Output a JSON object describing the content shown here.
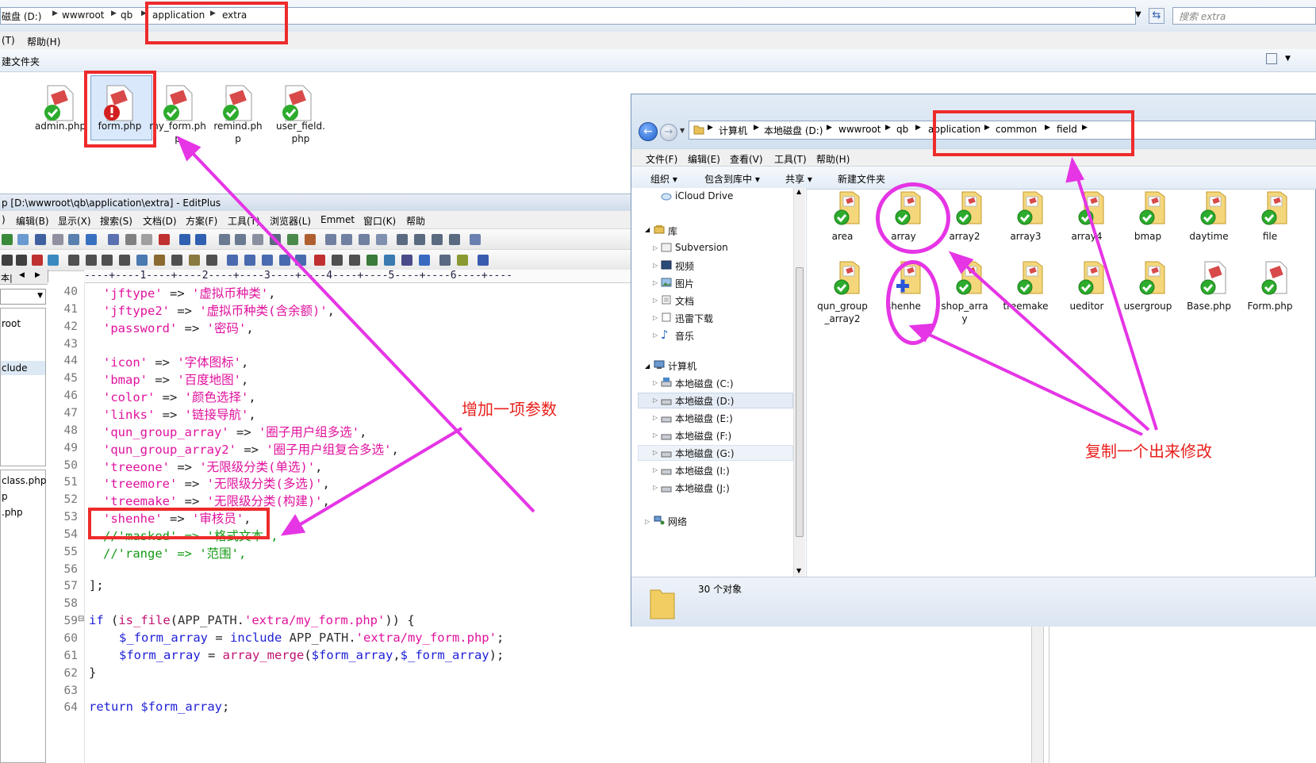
{
  "bg_explorer": {
    "breadcrumb": [
      "磁盘 (D:)",
      "wwwroot",
      "qb",
      "application",
      "extra"
    ],
    "search_placeholder": "搜索 extra",
    "menu": [
      "(T)",
      "帮助(H)"
    ],
    "cmd_label": "建文件夹",
    "files": [
      {
        "label": "admin.php",
        "status": "ok"
      },
      {
        "label": "form.php",
        "status": "error"
      },
      {
        "label": "my_form.php",
        "status": "ok"
      },
      {
        "label": "remind.php",
        "status": "ok"
      },
      {
        "label": "user_field.php",
        "status": "ok"
      }
    ]
  },
  "editplus": {
    "title": "p [D:\\wwwroot\\qb\\application\\extra] - EditPlus",
    "menu": [
      ")",
      "编辑(B)",
      "显示(X)",
      "搜索(S)",
      "文档(D)",
      "方案(F)",
      "工具(T)",
      "浏览器(L)",
      "Emmet",
      "窗口(K)",
      "帮助"
    ],
    "left_panel": [
      "本|",
      "root",
      "clude",
      "class.php",
      "p",
      ".php"
    ],
    "ruler": "----+----1----+----2----+----3----+----4----+----5----+----6----+----",
    "lines": [
      {
        "n": "40",
        "code": "'jftype' => '虚拟币种类',"
      },
      {
        "n": "41",
        "code": "'jftype2' => '虚拟币种类(含余额)',"
      },
      {
        "n": "42",
        "code": "'password' => '密码',"
      },
      {
        "n": "43",
        "code": ""
      },
      {
        "n": "44",
        "code": "'icon' => '字体图标',"
      },
      {
        "n": "45",
        "code": "'bmap' => '百度地图',"
      },
      {
        "n": "46",
        "code": "'color' => '颜色选择',"
      },
      {
        "n": "47",
        "code": "'links' => '链接导航',"
      },
      {
        "n": "48",
        "code": "'qun_group_array' => '圈子用户组多选',"
      },
      {
        "n": "49",
        "code": "'qun_group_array2' => '圈子用户组复合多选',"
      },
      {
        "n": "50",
        "code": "'treeone' => '无限级分类(单选)',"
      },
      {
        "n": "51",
        "code": "'treemore' => '无限级分类(多选)',"
      },
      {
        "n": "52",
        "code": "'treemake' => '无限级分类(构建)',"
      },
      {
        "n": "53",
        "code": "'shenhe' => '审核员',"
      },
      {
        "n": "54",
        "code": "//'masked' => '格式文本',"
      },
      {
        "n": "55",
        "code": "//'range' => '范围',"
      },
      {
        "n": "56",
        "code": ""
      },
      {
        "n": "57",
        "code": "];"
      },
      {
        "n": "58",
        "code": ""
      },
      {
        "n": "59",
        "code": "if (is_file(APP_PATH.'extra/my_form.php')) {"
      },
      {
        "n": "60",
        "code": "$_form_array = include APP_PATH.'extra/my_form.php';"
      },
      {
        "n": "61",
        "code": "$form_array = array_merge($form_array,$_form_array);"
      },
      {
        "n": "62",
        "code": "}"
      },
      {
        "n": "63",
        "code": ""
      },
      {
        "n": "64",
        "code": "return $form_array;"
      }
    ]
  },
  "explorer2": {
    "breadcrumb": [
      "计算机",
      "本地磁盘 (D:)",
      "wwwroot",
      "qb",
      "application",
      "common",
      "field"
    ],
    "menu": [
      "文件(F)",
      "编辑(E)",
      "查看(V)",
      "工具(T)",
      "帮助(H)"
    ],
    "commands": [
      "组织 ▾",
      "包含到库中 ▾",
      "共享 ▾",
      "新建文件夹"
    ],
    "sidebar": {
      "icloud": "iCloud Drive",
      "library": "库",
      "library_items": [
        "Subversion",
        "视频",
        "图片",
        "文档",
        "迅雷下载",
        "音乐"
      ],
      "computer": "计算机",
      "drives": [
        "本地磁盘 (C:)",
        "本地磁盘 (D:)",
        "本地磁盘 (E:)",
        "本地磁盘 (F:)",
        "本地磁盘 (G:)",
        "本地磁盘 (I:)",
        "本地磁盘 (J:)"
      ],
      "network": "网络"
    },
    "items_row1": [
      {
        "label": "area",
        "status": "ok"
      },
      {
        "label": "array",
        "status": "ok"
      },
      {
        "label": "array2",
        "status": "ok"
      },
      {
        "label": "array3",
        "status": "ok"
      },
      {
        "label": "array4",
        "status": "ok"
      },
      {
        "label": "bmap",
        "status": "ok"
      },
      {
        "label": "daytime",
        "status": "ok"
      },
      {
        "label": "file",
        "status": "ok"
      }
    ],
    "items_row2": [
      {
        "label": "qun_group_array2",
        "status": "ok"
      },
      {
        "label": "shenhe",
        "status": "add"
      },
      {
        "label": "shop_array",
        "status": "ok"
      },
      {
        "label": "treemake",
        "status": "ok"
      },
      {
        "label": "ueditor",
        "status": "ok"
      },
      {
        "label": "usergroup",
        "status": "ok"
      },
      {
        "label": "Base.php",
        "status": "ok"
      },
      {
        "label": "Form.php",
        "status": "ok"
      }
    ],
    "status_count": "30 个对象"
  },
  "annotations": {
    "add_param": "增加一项参数",
    "copy_modify": "复制一个出来修改"
  },
  "colors": {
    "annotation_red": "#ee2b2b",
    "annotation_magenta": "#e535e5",
    "code_string": "#e0129e",
    "code_comment": "#159a15",
    "code_keyword": "#2020d8"
  }
}
